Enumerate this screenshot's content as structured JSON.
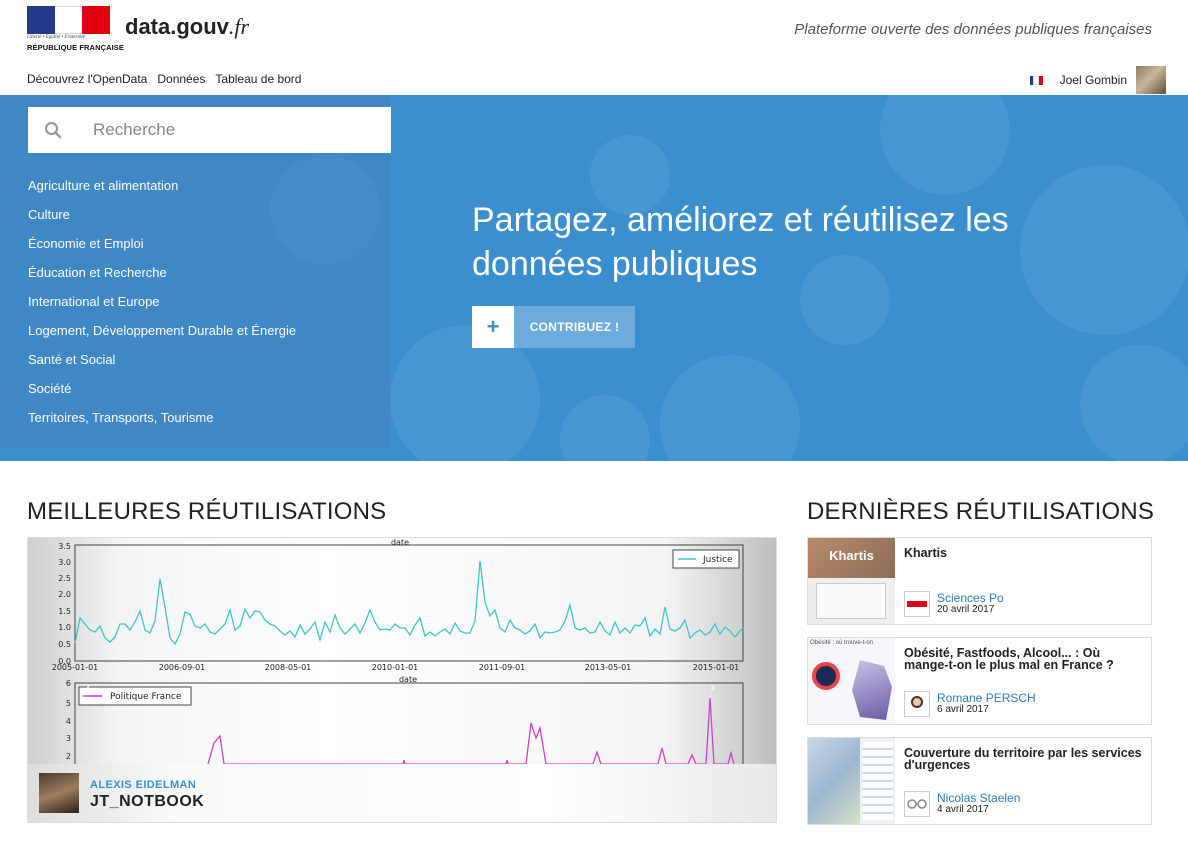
{
  "header": {
    "logo": {
      "motto": "Liberté • Égalité • Fraternité",
      "text": "RÉPUBLIQUE FRANÇAISE",
      "colors": [
        "#233a8b",
        "#ffffff",
        "#e1000f"
      ]
    },
    "brand_main": "data.gouv",
    "brand_ext": ".fr",
    "tagline": "Plateforme ouverte des données publiques françaises"
  },
  "nav": {
    "items": [
      "Découvrez l'OpenData",
      "Données",
      "Tableau de bord"
    ]
  },
  "user": {
    "language_icon": "french-flag-icon",
    "name": "Joel Gombin"
  },
  "hero": {
    "search_placeholder": "Recherche",
    "topics": [
      "Agriculture et alimentation",
      "Culture",
      "Économie et Emploi",
      "Éducation et Recherche",
      "International et Europe",
      "Logement, Développement Durable et Énergie",
      "Santé et Social",
      "Société",
      "Territoires, Transports, Tourisme"
    ],
    "title": "Partagez, améliorez et réutilisez les données publiques",
    "contribute_label": "CONTRIBUEZ !",
    "background_color": "#3b8fcf"
  },
  "best": {
    "title": "MEILLEURES RÉUTILISATIONS",
    "author": "ALEXIS EIDELMAN",
    "reuse_title": "JT_NOTBOOK",
    "plot1": {
      "axis_label": "date",
      "legend": "Justice",
      "y_ticks": [
        "3.5",
        "3.0",
        "2.5",
        "2.0",
        "1.5",
        "1.0",
        "0.5",
        "0.0"
      ],
      "x_ticks": [
        "2005-01-01",
        "2006-09-01",
        "2008-05-01",
        "2010-01-01",
        "2011-09-01",
        "2013-05-01",
        "2015-01-01"
      ],
      "color": "#3ec6c6"
    },
    "plot2": {
      "axis_label": "date",
      "legend": "Politique France",
      "y_ticks": [
        "6",
        "5",
        "4",
        "3",
        "2"
      ],
      "color": "#d13fd1"
    }
  },
  "latest": {
    "title": "DERNIÈRES RÉUTILISATIONS",
    "cards": [
      {
        "title": "Khartis",
        "org": "Sciences Po",
        "date": "20 avril 2017",
        "thumb_label": "Khartis"
      },
      {
        "title": "Obésité, Fastfoods, Alcool... : Où mange-t-on le plus mal en France ?",
        "org": "Romane PERSCH",
        "date": "6 avril 2017",
        "thumb_label": "Obésité : où trouve-t-on"
      },
      {
        "title": "Couverture du territoire par les services d'urgences",
        "org": "Nicolas Staelen",
        "date": "4 avril 2017",
        "thumb_label": ""
      }
    ]
  }
}
